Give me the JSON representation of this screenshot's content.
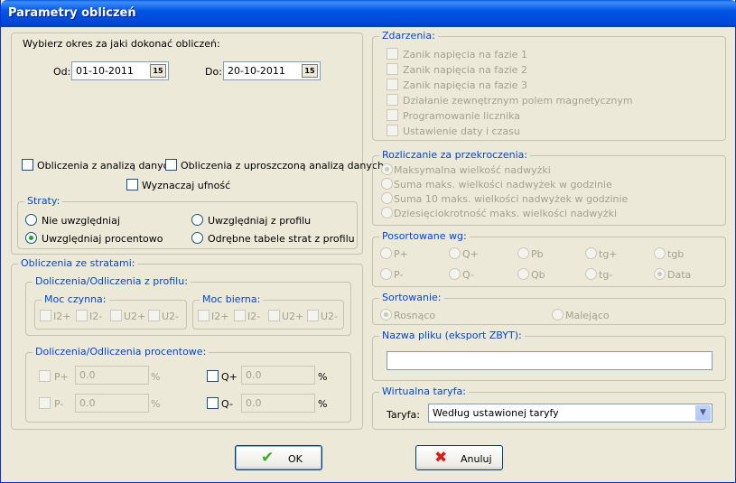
{
  "window": {
    "title": "Parametry obliczeń"
  },
  "period": {
    "heading": "Wybierz okres za jaki dokonać obliczeń:",
    "from_label": "Od:",
    "from_value": "01-10-2011",
    "to_label": "Do:",
    "to_value": "20-10-2011",
    "calendar_glyph": "15"
  },
  "options": {
    "analysis": "Obliczenia z analizą danych",
    "simplified": "Obliczenia z uproszczoną analizą danych",
    "uncertainty": "Wyznaczaj ufność"
  },
  "losses": {
    "legend": "Straty:",
    "not_include": "Nie uwzględniaj",
    "from_profile": "Uwzględniaj z profilu",
    "percent": "Uwzględniaj procentowo",
    "separate_tables": "Odrębne tabele strat z profilu",
    "selected": "percent"
  },
  "calc_losses": {
    "legend": "Obliczenia ze stratami:",
    "profile_legend": "Doliczenia/Odliczenia z profilu:",
    "active_legend": "Moc czynna:",
    "reactive_legend": "Moc bierna:",
    "active_items": [
      "I2+",
      "I2-",
      "U2+",
      "U2-"
    ],
    "reactive_items": [
      "I2+",
      "I2-",
      "U2+",
      "U2-"
    ],
    "percent_legend": "Doliczenia/Odliczenia procentowe:",
    "p_plus_label": "P+",
    "p_plus_value": "0.0",
    "p_minus_label": "P-",
    "p_minus_value": "0.0",
    "q_plus_label": "Q+",
    "q_plus_value": "0.0",
    "q_minus_label": "Q-",
    "q_minus_value": "0.0",
    "percent_sign": "%"
  },
  "events": {
    "legend": "Zdarzenia:",
    "items": [
      "Zanik napięcia na fazie 1",
      "Zanik napięcia na fazie 2",
      "Zanik napięcia na fazie 3",
      "Działanie zewnętrznym polem magnetycznym",
      "Programowanie licznika",
      "Ustawienie daty i czasu"
    ]
  },
  "overruns": {
    "legend": "Rozliczanie za przekroczenia:",
    "items": [
      "Maksymalna wielkość nadwyżki",
      "Suma maks. wielkości nadwyżek w godzinie",
      "Suma 10 maks. wielkości nadwyżek w godzinie",
      "Dziesięciokrotność maks. wielkości nadwyżki"
    ],
    "selected": 0
  },
  "sort_by": {
    "legend": "Posortowane wg:",
    "row1": [
      "P+",
      "Q+",
      "Pb",
      "tg+",
      "tgb"
    ],
    "row2": [
      "P-",
      "Q-",
      "Qb",
      "tg-",
      "Data"
    ],
    "selected": "Data"
  },
  "sorting": {
    "legend": "Sortowanie:",
    "asc": "Rosnąco",
    "desc": "Malejąco",
    "selected": "asc"
  },
  "filename": {
    "legend": "Nazwa pliku (eksport ZBYT):",
    "value": ""
  },
  "tariff": {
    "legend": "Wirtualna taryfa:",
    "label": "Taryfa:",
    "value": "Według ustawionej taryfy"
  },
  "buttons": {
    "ok": "OK",
    "cancel": "Anuluj"
  },
  "colors": {
    "titlebar": "#0055e5",
    "legend": "#0046d5",
    "disabled_text": "#a4a190",
    "ok_check": "#3cae1f",
    "cancel_x": "#d2221c"
  }
}
